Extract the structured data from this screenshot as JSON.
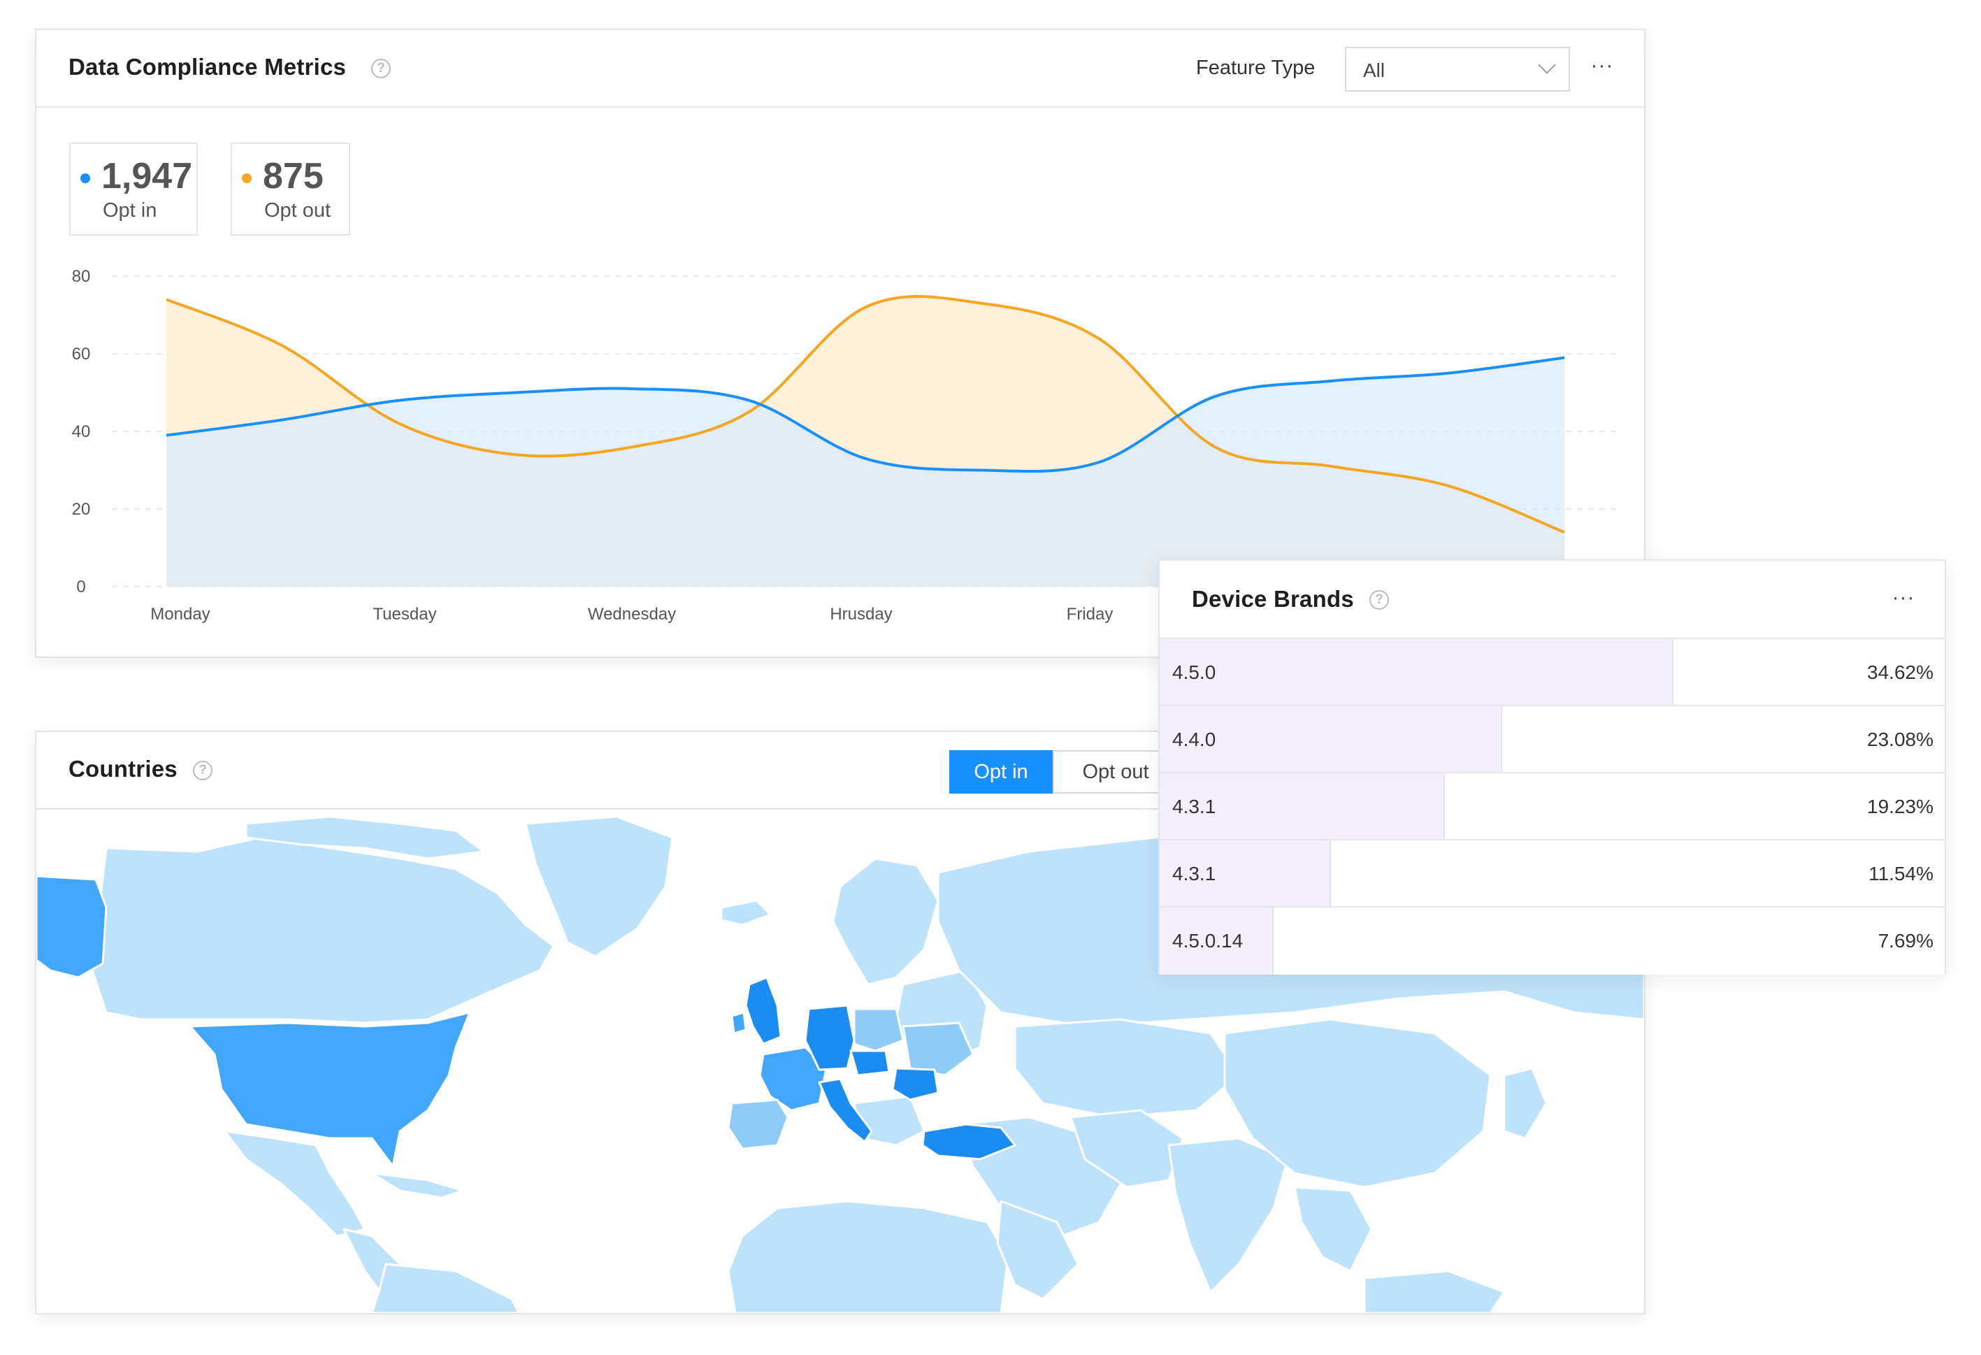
{
  "metrics": {
    "title": "Data Compliance Metrics",
    "help_icon": "question-circle-icon",
    "filter_label": "Feature Type",
    "filter_value": "All",
    "more_icon": "ellipsis-icon",
    "stats": [
      {
        "value": "1,947",
        "label": "Opt in",
        "color": "#1890ff"
      },
      {
        "value": "875",
        "label": "Opt out",
        "color": "#f5a623"
      }
    ]
  },
  "chart_data": {
    "type": "area",
    "categories": [
      "Monday",
      "Tuesday",
      "Wednesday",
      "Hrusday",
      "Friday"
    ],
    "y_ticks": [
      0,
      20,
      40,
      60,
      80
    ],
    "ylim": [
      0,
      80
    ],
    "grid": true,
    "series": [
      {
        "name": "Opt in",
        "color": "#1890ff",
        "fill": "#d9eafc",
        "x": [
          0,
          0.5,
          1,
          1.5,
          2,
          2.5,
          3,
          3.5,
          4,
          4.5,
          5,
          5.5,
          6
        ],
        "values": [
          39,
          43,
          48,
          50,
          51,
          48,
          33,
          30,
          32,
          49,
          53,
          55,
          59
        ]
      },
      {
        "name": "Opt out",
        "color": "#f5a623",
        "fill": "#fdf0d7",
        "x": [
          0,
          0.5,
          1,
          1.5,
          2,
          2.5,
          3,
          3.5,
          4,
          4.5,
          5,
          5.5,
          6
        ],
        "values": [
          74,
          62,
          42,
          34,
          36,
          45,
          72,
          73,
          64,
          36,
          31,
          26,
          14
        ]
      }
    ]
  },
  "countries": {
    "title": "Countries",
    "help_icon": "question-circle-icon",
    "toggle": [
      "Opt in",
      "Opt out"
    ],
    "active_toggle": "Opt in",
    "colors": {
      "base": "#bde2fb",
      "light": "#8ecbf7",
      "medium": "#42a6fa",
      "dark": "#1a8cf2"
    }
  },
  "brands": {
    "title": "Device Brands",
    "help_icon": "question-circle-icon",
    "more_icon": "ellipsis-icon",
    "rows": [
      {
        "label": "4.5.0",
        "pct": "34.62%",
        "value": 34.62
      },
      {
        "label": "4.4.0",
        "pct": "23.08%",
        "value": 23.08
      },
      {
        "label": "4.3.1",
        "pct": "19.23%",
        "value": 19.23
      },
      {
        "label": "4.3.1",
        "pct": "11.54%",
        "value": 11.54
      },
      {
        "label": "4.5.0.14",
        "pct": "7.69%",
        "value": 7.69
      }
    ]
  }
}
